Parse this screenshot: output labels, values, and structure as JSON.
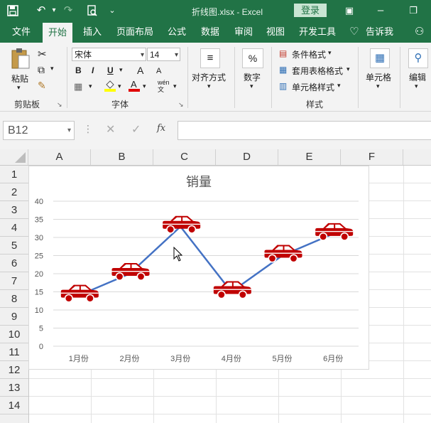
{
  "window": {
    "title": "折线图.xlsx  -  Excel",
    "login": "登录"
  },
  "tabs": [
    "文件",
    "开始",
    "插入",
    "页面布局",
    "公式",
    "数据",
    "审阅",
    "视图",
    "开发工具",
    "告诉我"
  ],
  "ribbon": {
    "clipboard": {
      "paste": "粘贴",
      "group": "剪贴板"
    },
    "font": {
      "name": "宋体",
      "size": "14",
      "bold": "B",
      "italic": "I",
      "underline": "U",
      "group": "字体",
      "wen": "wén 文",
      "grow": "A",
      "shrink": "A"
    },
    "align": {
      "label": "对齐方式"
    },
    "number": {
      "label": "数字",
      "icon": "%"
    },
    "styles": {
      "cond": "条件格式",
      "table": "套用表格格式",
      "cell": "单元格样式",
      "group": "样式"
    },
    "cells": {
      "label": "单元格"
    },
    "edit": {
      "label": "编辑"
    }
  },
  "formula_bar": {
    "name_box": "B12",
    "fx": "fx",
    "value": ""
  },
  "columns": [
    "A",
    "B",
    "C",
    "D",
    "E",
    "F"
  ],
  "rows": [
    "1",
    "2",
    "3",
    "4",
    "5",
    "6",
    "7",
    "8",
    "9",
    "10",
    "11",
    "12",
    "13",
    "14"
  ],
  "chart_data": {
    "type": "line",
    "title": "销量",
    "categories": [
      "1月份",
      "2月份",
      "3月份",
      "4月份",
      "5月份",
      "6月份"
    ],
    "values": [
      14,
      20,
      33,
      15,
      25,
      31
    ],
    "ylim": [
      0,
      40
    ],
    "yticks": [
      "0",
      "5",
      "10",
      "15",
      "20",
      "25",
      "30",
      "35",
      "40"
    ],
    "grid": true,
    "line_color": "#4472c4",
    "marker": "car-icon",
    "marker_color": "#c00000"
  }
}
